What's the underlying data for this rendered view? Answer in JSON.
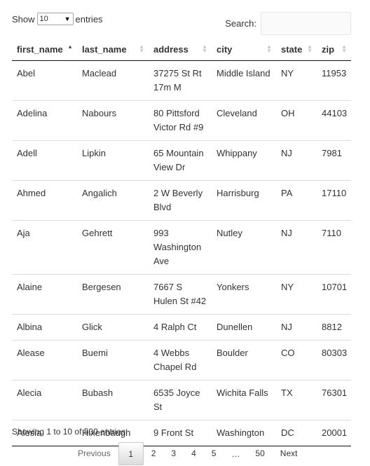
{
  "length": {
    "prefix": "Show",
    "value": "10",
    "suffix": "entries"
  },
  "search": {
    "label": "Search:",
    "value": ""
  },
  "table": {
    "columns": [
      "first_name",
      "last_name",
      "address",
      "city",
      "state",
      "zip"
    ],
    "rows": [
      {
        "first_name": "Abel",
        "last_name": "Maclead",
        "address": "37275 St Rt 17m M",
        "city": "Middle Island",
        "state": "NY",
        "zip": "11953"
      },
      {
        "first_name": "Adelina",
        "last_name": "Nabours",
        "address": "80 Pittsford Victor Rd #9",
        "city": "Cleveland",
        "state": "OH",
        "zip": "44103"
      },
      {
        "first_name": "Adell",
        "last_name": "Lipkin",
        "address": "65 Mountain View Dr",
        "city": "Whippany",
        "state": "NJ",
        "zip": "7981"
      },
      {
        "first_name": "Ahmed",
        "last_name": "Angalich",
        "address": "2 W Beverly Blvd",
        "city": "Harrisburg",
        "state": "PA",
        "zip": "17110"
      },
      {
        "first_name": "Aja",
        "last_name": "Gehrett",
        "address": "993 Washington Ave",
        "city": "Nutley",
        "state": "NJ",
        "zip": "7110"
      },
      {
        "first_name": "Alaine",
        "last_name": "Bergesen",
        "address": "7667 S Hulen St #42",
        "city": "Yonkers",
        "state": "NY",
        "zip": "10701"
      },
      {
        "first_name": "Albina",
        "last_name": "Glick",
        "address": "4 Ralph Ct",
        "city": "Dunellen",
        "state": "NJ",
        "zip": "8812"
      },
      {
        "first_name": "Alease",
        "last_name": "Buemi",
        "address": "4 Webbs Chapel Rd",
        "city": "Boulder",
        "state": "CO",
        "zip": "80303"
      },
      {
        "first_name": "Alecia",
        "last_name": "Bubash",
        "address": "6535 Joyce St",
        "city": "Wichita Falls",
        "state": "TX",
        "zip": "76301"
      },
      {
        "first_name": "Alesia",
        "last_name": "Hixenbaugh",
        "address": "9 Front St",
        "city": "Washington",
        "state": "DC",
        "zip": "20001"
      }
    ]
  },
  "info": "Showing 1 to 10 of 500 entries",
  "pagination": {
    "previous": "Previous",
    "pages": [
      "1",
      "2",
      "3",
      "4",
      "5"
    ],
    "ellipsis": "…",
    "last": "50",
    "next": "Next",
    "current": "1"
  }
}
